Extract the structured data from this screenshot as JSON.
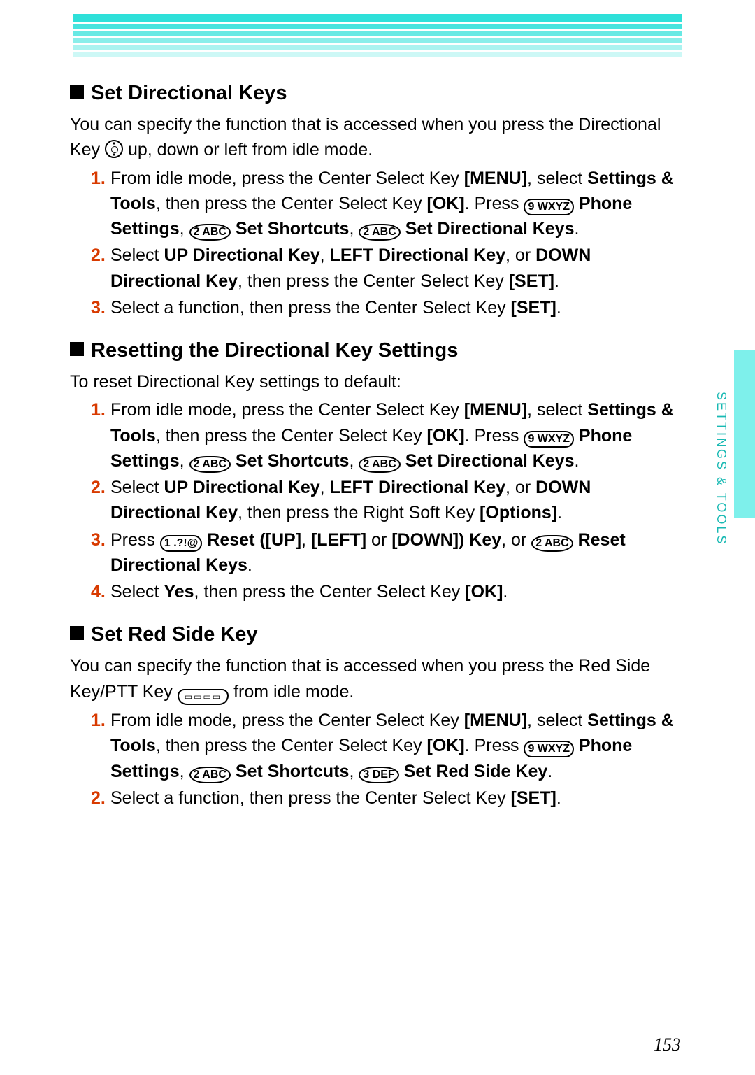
{
  "side_label": "SETTINGS & TOOLS",
  "page_number": "153",
  "keys": {
    "9": "9 WXYZ",
    "2": "2 ABC",
    "1": "1 .?!@",
    "3": "3 DEF",
    "ptt": "▭▭▭▭"
  },
  "s1": {
    "heading": "Set Directional Keys",
    "intro_a": "You can specify the function that is accessed when you press the Directional Key ",
    "intro_b": " up, down or left from idle mode.",
    "step1_a": "From idle mode, press the Center Select Key ",
    "step1_b": "[MENU]",
    "step1_c": ", select ",
    "step1_d": "Settings & Tools",
    "step1_e": ", then press the Center Select Key ",
    "step1_f": "[OK]",
    "step1_g": ". Press ",
    "step1_h": " Phone Settings",
    "step1_i": ", ",
    "step1_j": " Set Shortcuts",
    "step1_k": ", ",
    "step1_l": " Set Directional Keys",
    "step1_m": ".",
    "step2_a": "Select ",
    "step2_b": "UP Directional Key",
    "step2_c": ", ",
    "step2_d": "LEFT Directional Key",
    "step2_e": ", or ",
    "step2_f": "DOWN Directional Key",
    "step2_g": ", then press the Center Select Key ",
    "step2_h": "[SET]",
    "step2_i": ".",
    "step3_a": "Select a function, then press the Center Select Key ",
    "step3_b": "[SET]",
    "step3_c": "."
  },
  "s2": {
    "heading": "Resetting the Directional Key Settings",
    "intro": "To reset Directional Key settings to default:",
    "step1_a": "From idle mode, press the Center Select Key ",
    "step1_b": "[MENU]",
    "step1_c": ", select ",
    "step1_d": "Settings & Tools",
    "step1_e": ", then press the Center Select Key ",
    "step1_f": "[OK]",
    "step1_g": ". Press ",
    "step1_h": " Phone Settings",
    "step1_i": ", ",
    "step1_j": " Set Shortcuts",
    "step1_k": ", ",
    "step1_l": " Set Directional Keys",
    "step1_m": ".",
    "step2_a": "Select ",
    "step2_b": "UP Directional Key",
    "step2_c": ", ",
    "step2_d": "LEFT Directional Key",
    "step2_e": ", or ",
    "step2_f": "DOWN Directional Key",
    "step2_g": ", then press the Right Soft Key ",
    "step2_h": "[Options]",
    "step2_i": ".",
    "step3_a": "Press ",
    "step3_b": " Reset ([UP]",
    "step3_c": ", ",
    "step3_d": "[LEFT]",
    "step3_e": " or ",
    "step3_f": "[DOWN]) Key",
    "step3_g": ", or ",
    "step3_h": " Reset Directional Keys",
    "step3_i": ".",
    "step4_a": "Select ",
    "step4_b": "Yes",
    "step4_c": ", then press the Center Select Key ",
    "step4_d": "[OK]",
    "step4_e": "."
  },
  "s3": {
    "heading": "Set Red Side Key",
    "intro_a": "You can specify the function that is accessed when you press the Red Side Key/PTT Key ",
    "intro_b": " from idle mode.",
    "step1_a": "From idle mode, press the Center Select Key ",
    "step1_b": "[MENU]",
    "step1_c": ", select ",
    "step1_d": "Settings & Tools",
    "step1_e": ", then press the Center Select Key ",
    "step1_f": "[OK]",
    "step1_g": ". Press ",
    "step1_h": " Phone Settings",
    "step1_i": ", ",
    "step1_j": " Set Shortcuts",
    "step1_k": ", ",
    "step1_l": " Set Red Side Key",
    "step1_m": ".",
    "step2_a": "Select a function, then press the Center Select Key ",
    "step2_b": "[SET]",
    "step2_c": "."
  },
  "nums": {
    "n1": "1.",
    "n2": "2.",
    "n3": "3.",
    "n4": "4."
  }
}
